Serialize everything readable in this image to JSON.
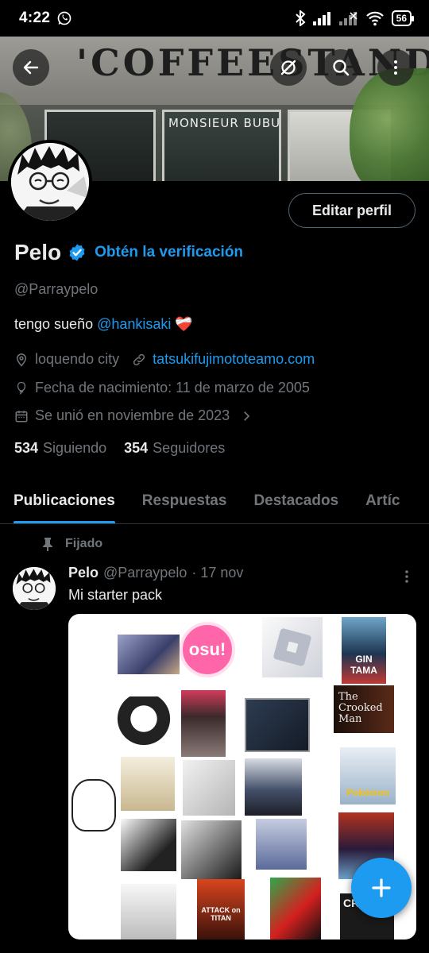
{
  "status_bar": {
    "time": "4:22",
    "battery": "56"
  },
  "profile": {
    "name": "Pelo",
    "verification_cta": "Obtén la verificación",
    "handle": "@Parraypelo",
    "bio_text": "tengo sueño",
    "bio_mention": "@hankisaki",
    "bio_emoji": "❤️‍🩹",
    "location": "loquendo city",
    "website": "tatsukifujimototeamo.com",
    "birthday": "Fecha de nacimiento: 11 de marzo de 2005",
    "joined": "Se unió en noviembre de 2023",
    "following_count": "534",
    "following_label": "Siguiendo",
    "followers_count": "354",
    "followers_label": "Seguidores",
    "edit_button": "Editar perfil"
  },
  "banner": {
    "sign_text": "'COFFEESTAND'",
    "chalk_text": "MONSIEUR BUBU"
  },
  "tabs": [
    "Publicaciones",
    "Respuestas",
    "Destacados",
    "Artíc"
  ],
  "post": {
    "pinned_label": "Fijado",
    "author": "Pelo",
    "handle": "@Parraypelo",
    "date": "· 17 nov",
    "text": "Mi starter pack",
    "media_tile_texts": {
      "osu": "osu!",
      "gintama": "GIN TAMA",
      "crooked": "The Crooked Man",
      "pokemon": "Pokémon",
      "aot": "ATTACK on TITAN",
      "cr": "CR"
    }
  },
  "colors": {
    "accent": "#1d9bf0",
    "background": "#000000",
    "muted": "#71767b",
    "text": "#e7e9ea"
  }
}
